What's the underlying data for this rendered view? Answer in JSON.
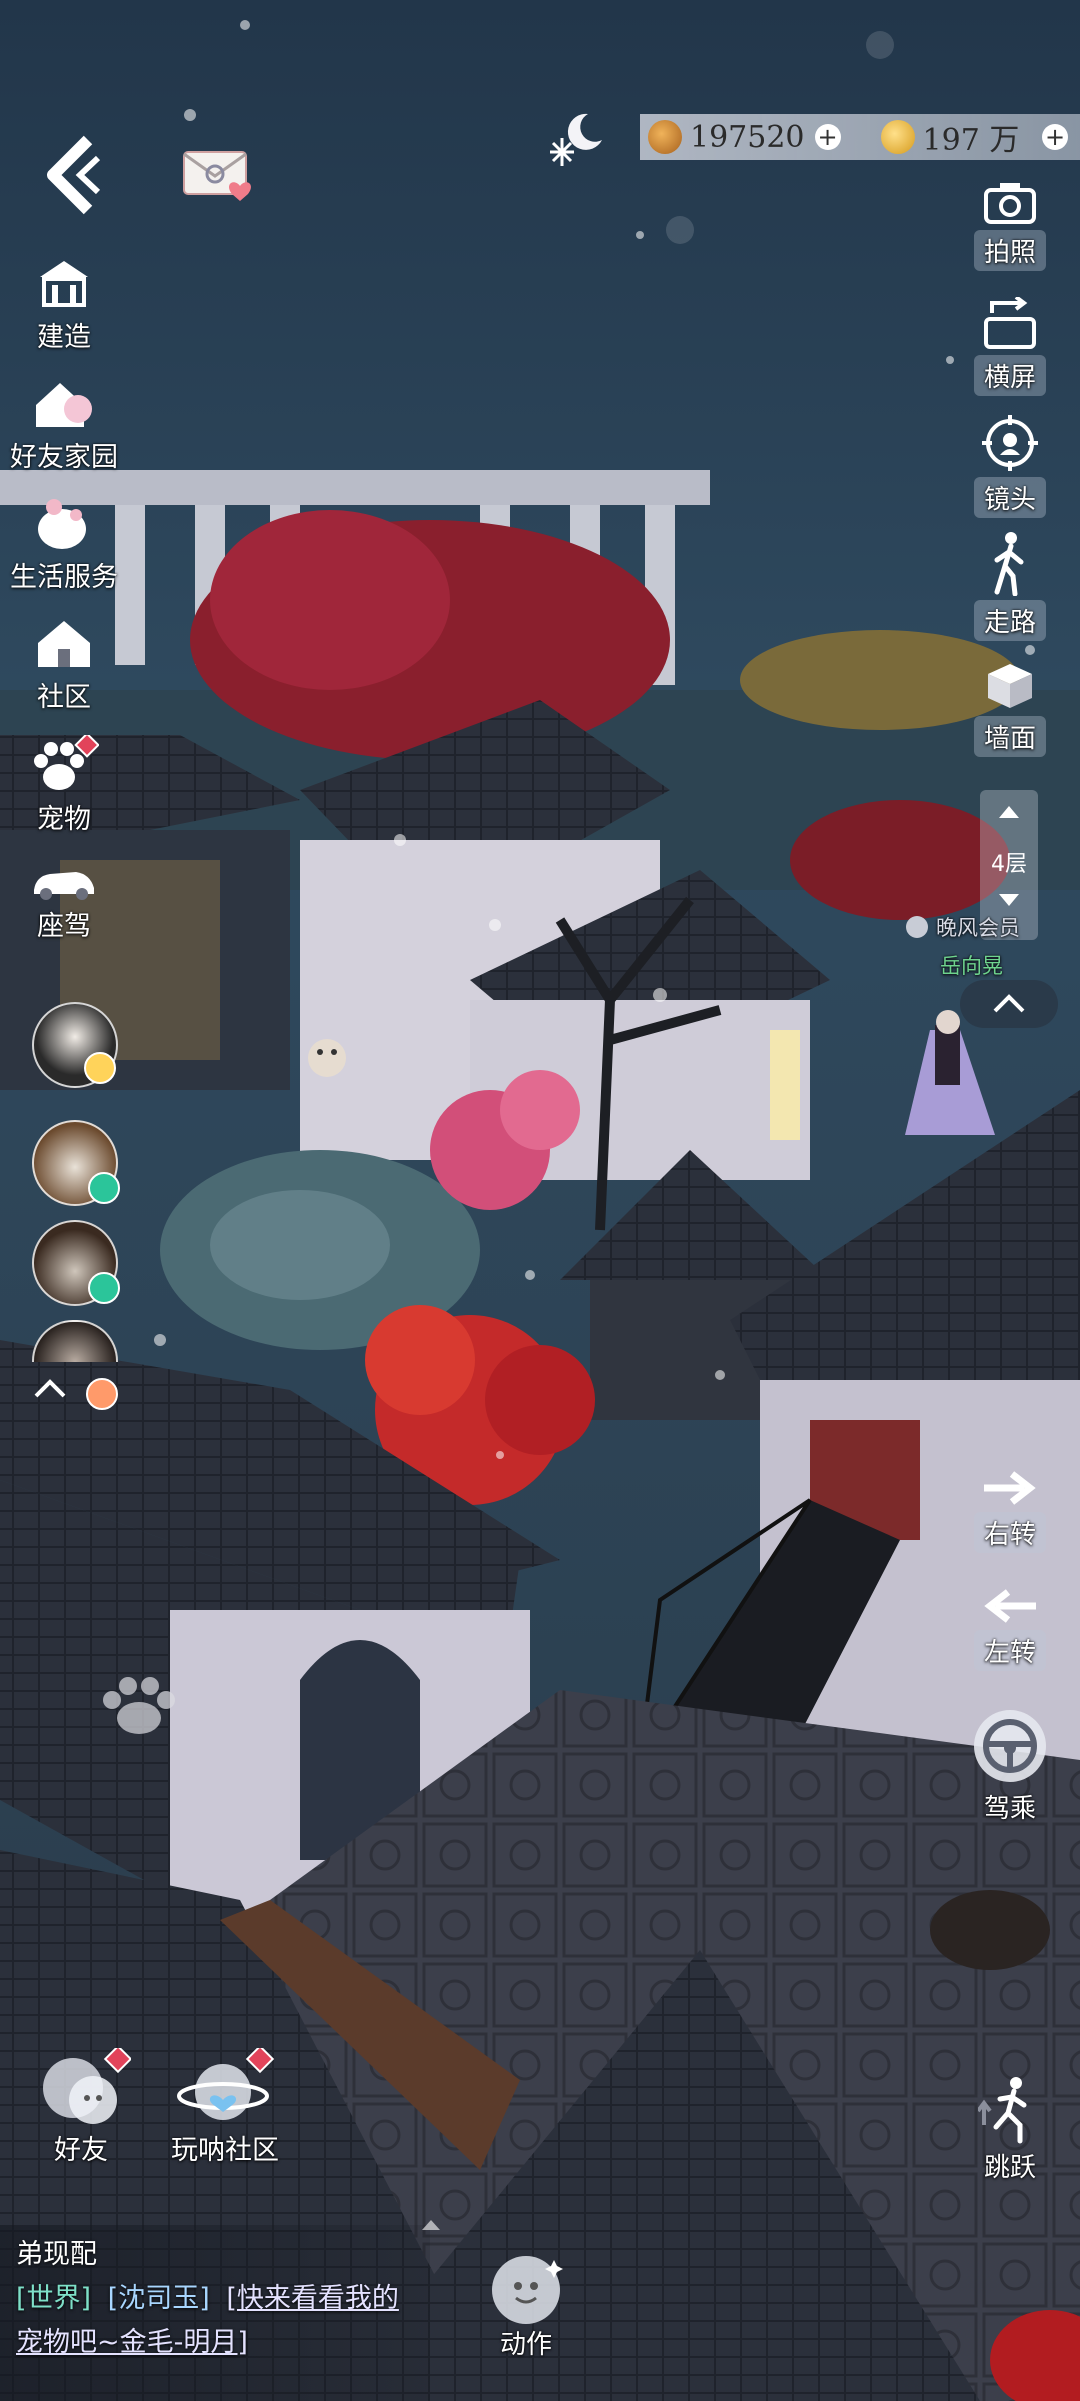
{
  "currency": {
    "coins": "197520",
    "gems": "197 万"
  },
  "left_menu": [
    {
      "label": "建造",
      "icon": "house-build-icon"
    },
    {
      "label": "好友家园",
      "icon": "friend-home-icon"
    },
    {
      "label": "生活服务",
      "icon": "life-service-icon"
    },
    {
      "label": "社区",
      "icon": "community-icon"
    },
    {
      "label": "宠物",
      "icon": "paw-icon"
    },
    {
      "label": "座驾",
      "icon": "car-icon"
    }
  ],
  "right_menu": [
    {
      "label": "拍照",
      "icon": "camera-icon"
    },
    {
      "label": "横屏",
      "icon": "rotate-screen-icon"
    },
    {
      "label": "镜头",
      "icon": "camera-target-icon"
    },
    {
      "label": "走路",
      "icon": "walk-icon"
    },
    {
      "label": "墙面",
      "icon": "cube-wall-icon"
    }
  ],
  "floor": {
    "label": "4层"
  },
  "player": {
    "guild": "晚风会员",
    "name": "岳向晃"
  },
  "turn_controls": [
    {
      "label": "右转",
      "icon": "arrow-right-icon"
    },
    {
      "label": "左转",
      "icon": "arrow-left-icon"
    }
  ],
  "drive": {
    "label": "驾乘",
    "icon": "steering-wheel-icon"
  },
  "jump": {
    "label": "跳跃",
    "icon": "jump-icon"
  },
  "bottom_buttons": [
    {
      "label": "好友",
      "icon": "friends-icon"
    },
    {
      "label": "玩呐社区",
      "icon": "planet-community-icon"
    }
  ],
  "action": {
    "label": "动作",
    "icon": "action-icon"
  },
  "chat": {
    "line1": "弟现配",
    "channel": "[世界]",
    "sender": "[沈司玉]",
    "message_a": "[快来看看我的",
    "message_b": "宠物吧~金毛-明月]"
  },
  "colors": {
    "sky_top": "#243848",
    "sky_bottom": "#35536a",
    "roof": "#2e3440",
    "wall": "#d9d6e0",
    "tree_red": "#b3232c",
    "tree_pink": "#e05a84",
    "green_name": "#6ed38e",
    "chat_channel": "#7ee0c8",
    "chat_link": "#e4e2ff"
  }
}
